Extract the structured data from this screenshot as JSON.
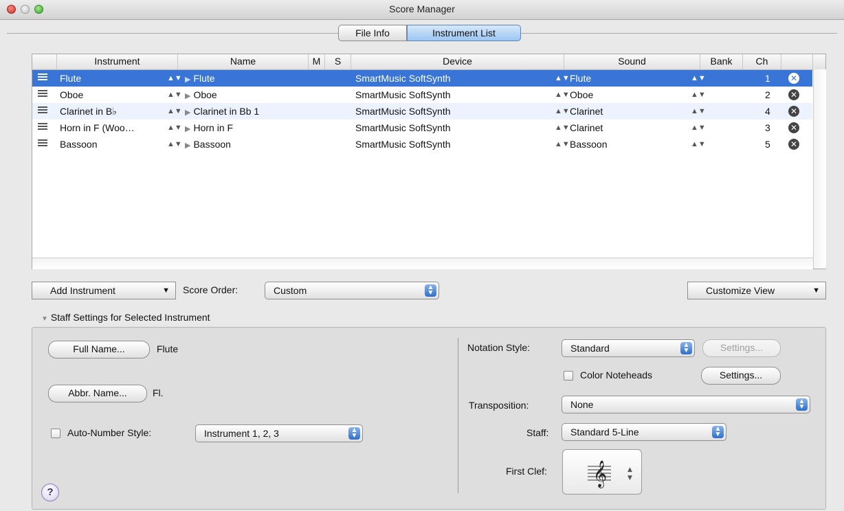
{
  "window": {
    "title": "Score Manager"
  },
  "tabs": [
    {
      "label": "File Info"
    },
    {
      "label": "Instrument List"
    }
  ],
  "table": {
    "columns": [
      "Instrument",
      "Name",
      "M",
      "S",
      "Device",
      "Sound",
      "Bank",
      "Ch"
    ],
    "rows": [
      {
        "instrument": "Flute",
        "name": "Flute",
        "device": "SmartMusic SoftSynth",
        "sound": "Flute",
        "bank": "",
        "ch": "1"
      },
      {
        "instrument": "Oboe",
        "name": "Oboe",
        "device": "SmartMusic SoftSynth",
        "sound": "Oboe",
        "bank": "",
        "ch": "2"
      },
      {
        "instrument": "Clarinet in B♭",
        "name": "Clarinet in Bb 1",
        "device": "SmartMusic SoftSynth",
        "sound": "Clarinet",
        "bank": "",
        "ch": "4"
      },
      {
        "instrument": "Horn in F (Woo…",
        "name": "Horn in F",
        "device": "SmartMusic SoftSynth",
        "sound": "Clarinet",
        "bank": "",
        "ch": "3"
      },
      {
        "instrument": "Bassoon",
        "name": "Bassoon",
        "device": "SmartMusic SoftSynth",
        "sound": "Bassoon",
        "bank": "",
        "ch": "5"
      }
    ]
  },
  "toolbar": {
    "add_instrument": "Add Instrument",
    "score_order_label": "Score Order:",
    "score_order_value": "Custom",
    "customize_view": "Customize View"
  },
  "staff_settings": {
    "section_title": "Staff Settings for Selected Instrument",
    "full_name_button": "Full Name...",
    "full_name_value": "Flute",
    "abbr_name_button": "Abbr. Name...",
    "abbr_name_value": "Fl.",
    "auto_number_label": "Auto-Number Style:",
    "auto_number_value": "Instrument 1, 2, 3",
    "notation_style_label": "Notation Style:",
    "notation_style_value": "Standard",
    "settings_button_disabled": "Settings...",
    "color_noteheads_label": "Color Noteheads",
    "settings_button": "Settings...",
    "transposition_label": "Transposition:",
    "transposition_value": "None",
    "staff_label": "Staff:",
    "staff_value": "Standard 5-Line",
    "first_clef_label": "First Clef:",
    "help": "?"
  },
  "colors": {
    "selection": "#3875d7",
    "alt_row": "#edf3fe"
  },
  "icons": [
    "drag-handle-icon",
    "stepper-icon",
    "disclosure-triangle-icon",
    "delete-row-icon",
    "treble-clef-icon",
    "help-icon"
  ]
}
